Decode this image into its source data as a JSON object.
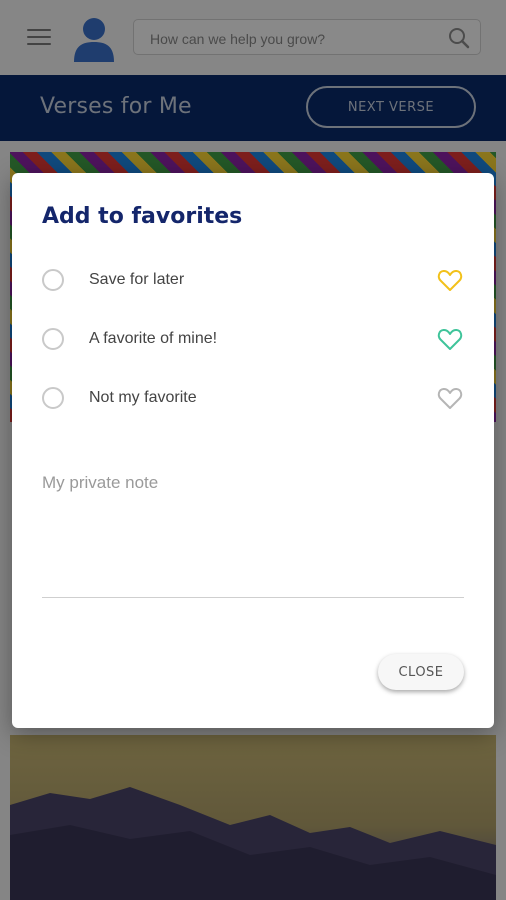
{
  "search": {
    "placeholder": "How can we help you grow?",
    "icon": "search-icon"
  },
  "header": {
    "title": "Verses for Me",
    "next_label": "NEXT VERSE"
  },
  "dialog": {
    "title": "Add to favorites",
    "options": [
      {
        "label": "Save for later",
        "heart_color": "#f2c11a"
      },
      {
        "label": "A favorite of mine!",
        "heart_color": "#3fc49a"
      },
      {
        "label": "Not my favorite",
        "heart_color": "#b5b5b5"
      }
    ],
    "note_placeholder": "My private note",
    "close_label": "CLOSE"
  },
  "colors": {
    "header_bg": "#0a2a6b",
    "title_blue": "#14266b",
    "avatar_blue": "#3a70c8"
  }
}
